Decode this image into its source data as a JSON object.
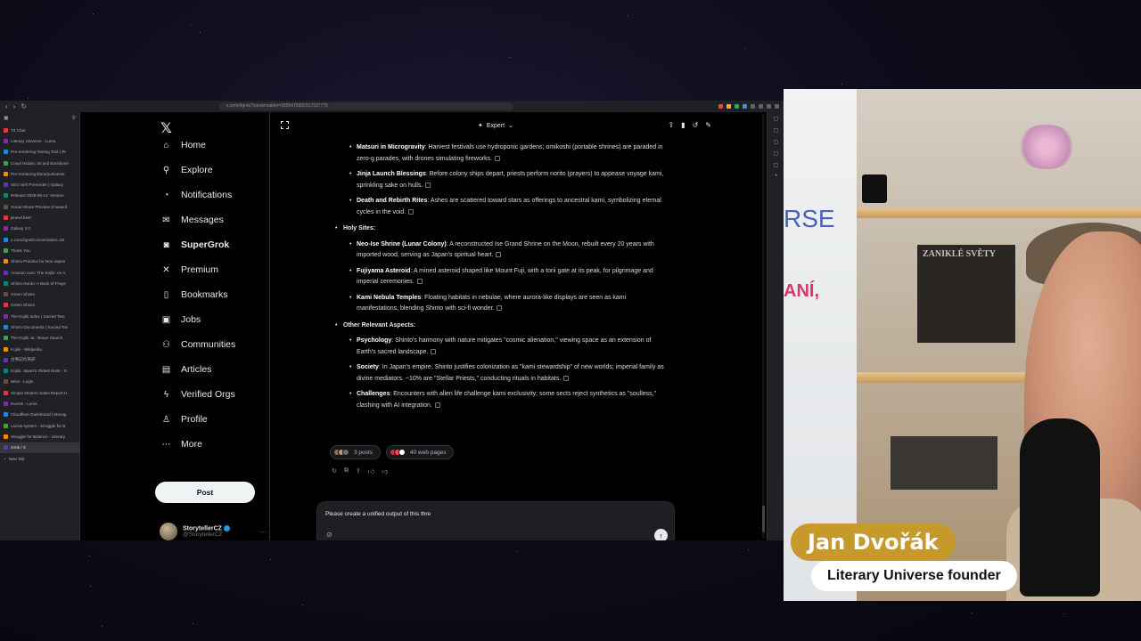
{
  "browser": {
    "url": "x.com/i/grok?conversation=1895476820317937775",
    "tabs": [
      "T3 Chat",
      "Literary Universe - Luma",
      "Pre-rendering Testing Tool | Te",
      "Crawl Hidden JS and Backbone",
      "Pre-rendering literaryuniverse",
      "SEO with Prerender | Galaxy",
      "Release 2025-08-14: Version",
      "Social Share Preview of www.li",
      "jsnewl.best",
      "Galaxy 2.0",
      "x.com/i/grok/conversation=18",
      "Thank You",
      "Shinto Practice for Non-Japan",
      "Amazon.com: The Kojiki: An A",
      "Shinto Norito: A Book of Praye",
      "Green Shinto",
      "Green Shinto",
      "The Kojiki Index | Sacred Text",
      "Shinto Documents | Sacred Tex",
      "The Kojiki Ja - Brave Search",
      "Kojiki - Wikipedia",
      "古事記の英訳",
      "Kojiki: Japan's Oldest Book - G",
      "Wise - Login",
      "Simple Modern Sales Report H",
      "Events - Luma",
      "Cloudflare Dashboard | Manag",
      "Lazow system - Struggle for B",
      "Struggle for Balance - Literary",
      "Grok / X"
    ],
    "new_tab": "New Tab"
  },
  "x_nav": {
    "items": [
      {
        "label": "Home",
        "icon": "home-icon",
        "glyph": "⌂"
      },
      {
        "label": "Explore",
        "icon": "search-icon",
        "glyph": "⚲"
      },
      {
        "label": "Notifications",
        "icon": "bell-icon",
        "glyph": "◔"
      },
      {
        "label": "Messages",
        "icon": "mail-icon",
        "glyph": "✉"
      },
      {
        "label": "SuperGrok",
        "icon": "grok-icon",
        "glyph": "◙"
      },
      {
        "label": "Premium",
        "icon": "x-premium-icon",
        "glyph": "✕"
      },
      {
        "label": "Bookmarks",
        "icon": "bookmark-icon",
        "glyph": "▯"
      },
      {
        "label": "Jobs",
        "icon": "briefcase-icon",
        "glyph": "▣"
      },
      {
        "label": "Communities",
        "icon": "people-icon",
        "glyph": "⚇"
      },
      {
        "label": "Articles",
        "icon": "article-icon",
        "glyph": "▤"
      },
      {
        "label": "Verified Orgs",
        "icon": "lightning-icon",
        "glyph": "ϟ"
      },
      {
        "label": "Profile",
        "icon": "person-icon",
        "glyph": "♙"
      },
      {
        "label": "More",
        "icon": "more-icon",
        "glyph": "⋯"
      }
    ],
    "post_label": "Post",
    "account_name": "StorytellerCZ",
    "account_handle": "@StorytellerCZ"
  },
  "grok": {
    "mode": "Expert",
    "sections": [
      {
        "title": null,
        "items": [
          {
            "term": "Matsuri in Microgravity",
            "text": "Harvest festivals use hydroponic gardens; omikoshi (portable shrines) are paraded in zero-g parades, with drones simulating fireworks."
          },
          {
            "term": "Jinja Launch Blessings",
            "text": "Before colony ships depart, priests perform norito (prayers) to appease voyage kami, sprinkling sake on hulls."
          },
          {
            "term": "Death and Rebirth Rites",
            "text": "Ashes are scattered toward stars as offerings to ancestral kami, symbolizing eternal cycles in the void."
          }
        ]
      },
      {
        "title": "Holy Sites:",
        "items": [
          {
            "term": "Neo-Ise Shrine (Lunar Colony)",
            "text": "A reconstructed Ise Grand Shrine on the Moon, rebuilt every 20 years with imported wood, serving as Japan's spiritual heart."
          },
          {
            "term": "Fujiyama Asteroid",
            "text": "A mined asteroid shaped like Mount Fuji, with a torii gate at its peak, for pilgrimage and imperial ceremonies."
          },
          {
            "term": "Kami Nebula Temples",
            "text": "Floating habitats in nebulae, where aurora-like displays are seen as kami manifestations, blending Shinto with sci-fi wonder."
          }
        ]
      },
      {
        "title": "Other Relevant Aspects:",
        "items": [
          {
            "term": "Psychology",
            "text": "Shinto's harmony with nature mitigates \"cosmic alienation,\" viewing space as an extension of Earth's sacred landscape."
          },
          {
            "term": "Society",
            "text": "In Japan's empire, Shinto justifies colonization as \"kami stewardship\" of new worlds; imperial family as divine mediators. ~10% are \"Stellar Priests,\" conducting rituals in habitats."
          },
          {
            "term": "Challenges",
            "text": "Encounters with alien life challenge kami exclusivity; some sects reject synthetics as \"soulless,\" clashing with AI integration."
          }
        ]
      }
    ],
    "sources_posts": "3 posts",
    "sources_web": "40 web pages",
    "composer_text": "Please create a unified output of this thre"
  },
  "overlay": {
    "name": "Jan Dvořák",
    "title": "Literary Universe founder",
    "wall_text_1": "RSE",
    "wall_text_2": "ANÍ,",
    "book_title": "ZANIKLÉ SVĚTY"
  },
  "colors": {
    "accent_gold": "#c59a2a",
    "x_blue": "#1d9bf0",
    "bg": "#000000"
  }
}
